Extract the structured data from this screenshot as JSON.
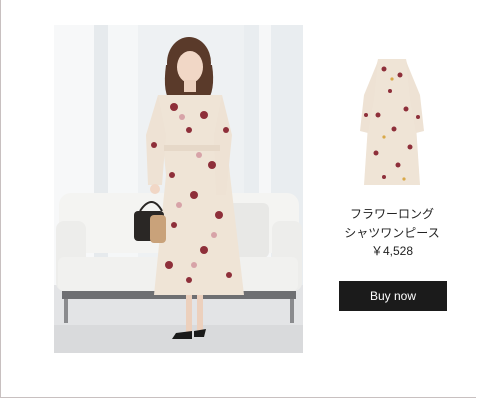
{
  "product": {
    "name_line1": "フラワーロング",
    "name_line2": "シャツワンピース",
    "price": "￥4,528",
    "buy_label": "Buy now"
  },
  "colors": {
    "button_bg": "#1b1b1b",
    "button_text": "#ffffff",
    "dress_base": "#efe4d6",
    "flower_red": "#8e2f3a"
  }
}
